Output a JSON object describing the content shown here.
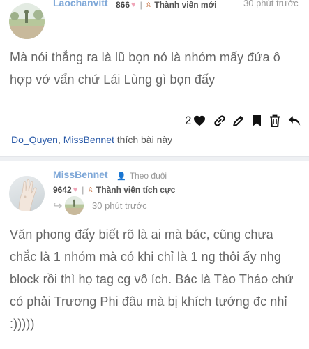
{
  "post1": {
    "username": "Laochanvitt",
    "points": "866",
    "rank": "Thành viên mới",
    "time": "30 phút trước",
    "body": "Mà nói thẳng ra là lũ bọn nó là nhóm mấy đứa ô hợp vớ vẩn chứ Lái Lùng gì bọn đấy",
    "like_count": "2",
    "likers": [
      "Do_Quyen",
      "MissBennet"
    ],
    "likes_suffix": "thích bài này",
    "likers_sep": ", "
  },
  "post2": {
    "username": "MissBennet",
    "follow_label": "Theo đuôi",
    "points": "9642",
    "rank": "Thành viên tích cực",
    "time": "30 phút trước",
    "body": "Văn phong đấy biết rõ là ai mà bác, cũng chưa chắc là 1 nhóm mà có khi chỉ là 1 ng thôi ấy nhg block rồi thì họ tag cg vô ích. Bác là Tào Tháo chứ có phải Trương Phi đâu mà bị khích tướng đc nhỉ :)))))"
  },
  "icons": {
    "heart": "heart-icon",
    "link": "link-icon",
    "edit": "pencil-icon",
    "bookmark": "bookmark-icon",
    "delete": "trash-icon",
    "reply": "reply-icon"
  },
  "colors": {
    "username": "#7fa8d8",
    "liker": "#2a5aa8",
    "heart_small": "#f0a5b8",
    "rank_icon": "#d08a63"
  }
}
